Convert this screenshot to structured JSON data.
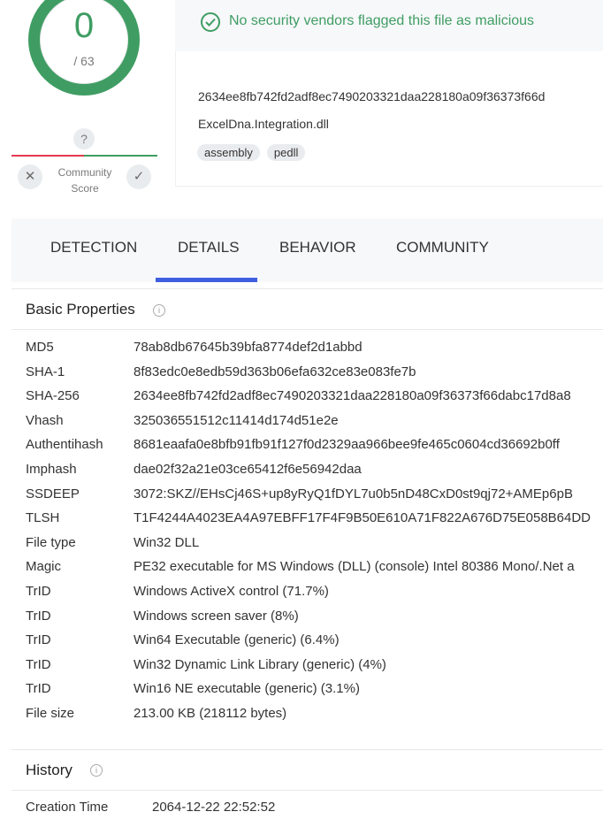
{
  "score": {
    "detections": "0",
    "total": "/ 63"
  },
  "community": {
    "question": "?",
    "label_line1": "Community",
    "label_line2": "Score"
  },
  "banner": {
    "message": "No security vendors flagged this file as malicious"
  },
  "file": {
    "hash": "2634ee8fb742fd2adf8ec7490203321daa228180a09f36373f66d",
    "name": "ExcelDna.Integration.dll",
    "tags": [
      "assembly",
      "pedll"
    ]
  },
  "tabs": [
    "DETECTION",
    "DETAILS",
    "BEHAVIOR",
    "COMMUNITY"
  ],
  "active_tab": "DETAILS",
  "basic": {
    "title": "Basic Properties",
    "rows": [
      {
        "k": "MD5",
        "v": "78ab8db67645b39bfa8774def2d1abbd"
      },
      {
        "k": "SHA-1",
        "v": "8f83edc0e8edb59d363b06efa632ce83e083fe7b"
      },
      {
        "k": "SHA-256",
        "v": "2634ee8fb742fd2adf8ec7490203321daa228180a09f36373f66dabc17d8a8"
      },
      {
        "k": "Vhash",
        "v": "325036551512c11414d174d51e2e"
      },
      {
        "k": "Authentihash",
        "v": "8681eaafa0e8bfb91fb91f127f0d2329aa966bee9fe465c0604cd36692b0ff"
      },
      {
        "k": "Imphash",
        "v": "dae02f32a21e03ce65412f6e56942daa"
      },
      {
        "k": "SSDEEP",
        "v": "3072:SKZ//EHsCj46S+up8yRyQ1fDYL7u0b5nD48CxD0st9qj72+AMEp6pB"
      },
      {
        "k": "TLSH",
        "v": "T1F4244A4023EA4A97EBFF17F4F9B50E610A71F822A676D75E058B64DD"
      },
      {
        "k": "File type",
        "v": "Win32 DLL"
      },
      {
        "k": "Magic",
        "v": "PE32 executable for MS Windows (DLL) (console) Intel 80386 Mono/.Net a"
      },
      {
        "k": "TrID",
        "v": "Windows ActiveX control (71.7%)"
      },
      {
        "k": "TrID",
        "v": "Windows screen saver (8%)"
      },
      {
        "k": "TrID",
        "v": "Win64 Executable (generic) (6.4%)"
      },
      {
        "k": "TrID",
        "v": "Win32 Dynamic Link Library (generic) (4%)"
      },
      {
        "k": "TrID",
        "v": "Win16 NE executable (generic) (3.1%)"
      },
      {
        "k": "File size",
        "v": "213.00 KB (218112 bytes)"
      }
    ]
  },
  "history": {
    "title": "History",
    "rows": [
      {
        "k": "Creation Time",
        "v": "2064-12-22 22:52:52"
      }
    ]
  },
  "colors": {
    "clean": "#3f9d63",
    "malicious": "#e53a4e",
    "tab_active": "#3f5fe0"
  }
}
